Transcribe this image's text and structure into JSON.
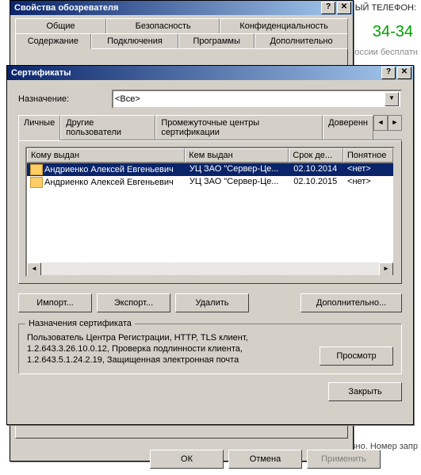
{
  "bg_phone_label": "ННЫЙ ТЕЛЕФОН:",
  "bg_phone": "34-34",
  "bg_free": "России бесплатн",
  "bg_bottom": "равно. Номер запр",
  "props": {
    "title": "Свойства обозревателя",
    "tabs_row1": [
      "Общие",
      "Безопасность",
      "Конфиденциальность"
    ],
    "tabs_row2": [
      "Содержание",
      "Подключения",
      "Программы",
      "Дополнительно"
    ],
    "active_tab": "Содержание",
    "ok": "ОК",
    "cancel": "Отмена",
    "apply": "Применить"
  },
  "certs": {
    "title": "Сертификаты",
    "purpose_label": "Назначение:",
    "purpose_value": "<Все>",
    "tabs": [
      "Личные",
      "Другие пользователи",
      "Промежуточные центры сертификации",
      "Доверенн"
    ],
    "active_tab": "Личные",
    "cols": [
      "Кому выдан",
      "Кем выдан",
      "Срок де...",
      "Понятное"
    ],
    "rows": [
      {
        "to": "Андриенко Алексей Евгеньевич",
        "by": "УЦ ЗАО \"Сервер-Це...",
        "date": "02.10.2014",
        "name": "<нет>",
        "sel": true
      },
      {
        "to": "Андриенко Алексей Евгеньевич",
        "by": "УЦ ЗАО \"Сервер-Це...",
        "date": "02.10.2015",
        "name": "<нет>",
        "sel": false
      }
    ],
    "import": "Импорт...",
    "export": "Экспорт...",
    "delete": "Удалить",
    "more": "Дополнительно...",
    "group_title": "Назначения сертификата",
    "group_text": "Пользователь Центра Регистрации, HTTP, TLS клиент,\n1.2.643.3.26.10.0.12, Проверка подлинности клиента,\n1.2.643.5.1.24.2.19, Защищенная электронная почта",
    "view": "Просмотр",
    "close": "Закрыть"
  }
}
